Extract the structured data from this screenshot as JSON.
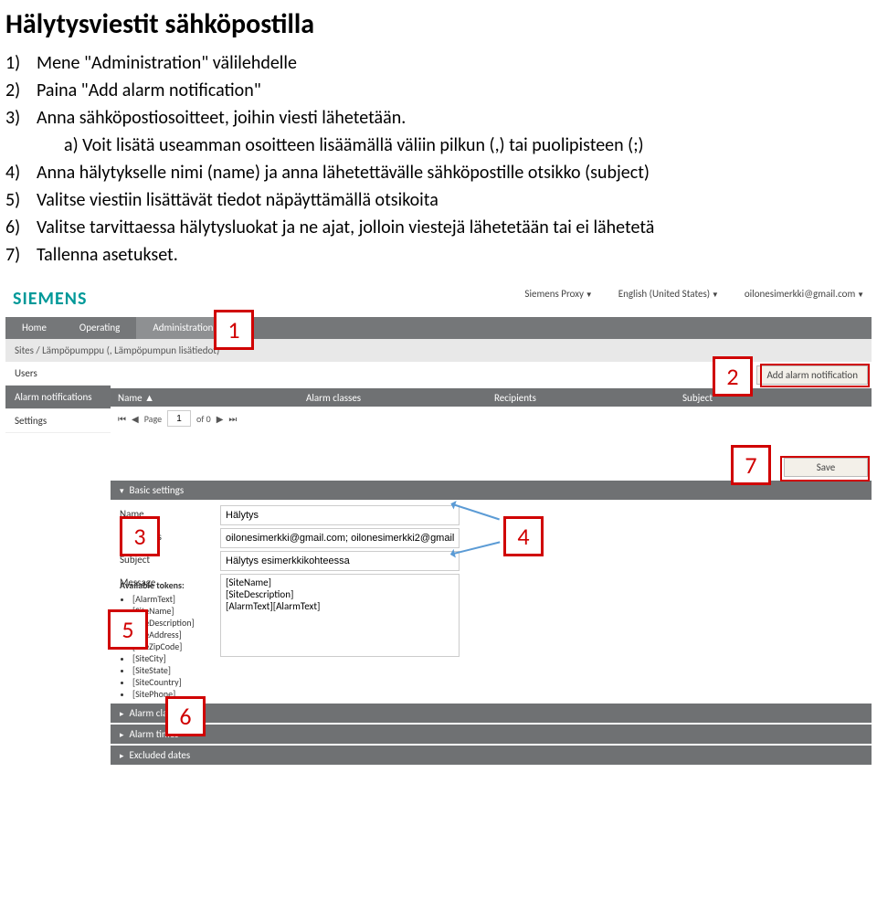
{
  "doc": {
    "title": "Hälytysviestit sähköpostilla",
    "steps": [
      {
        "n": "1)",
        "t": "Mene \"Administration\" välilehdelle"
      },
      {
        "n": "2)",
        "t": "Paina \"Add alarm notification\""
      },
      {
        "n": "3)",
        "t": "Anna sähköpostiosoitteet, joihin viesti lähetetään."
      },
      {
        "n": "",
        "t": "a)   Voit lisätä useamman osoitteen lisäämällä väliin pilkun (,) tai puolipisteen (;)",
        "sub": true
      },
      {
        "n": "4)",
        "t": "Anna hälytykselle nimi (name) ja anna lähetettävälle sähköpostille otsikko (subject)"
      },
      {
        "n": "5)",
        "t": "Valitse viestiin lisättävät tiedot näpäyttämällä otsikoita"
      },
      {
        "n": "6)",
        "t": "Valitse tarvittaessa hälytysluokat ja ne ajat, jolloin viestejä lähetetään tai ei lähetetä"
      },
      {
        "n": "7)",
        "t": "Tallenna asetukset."
      }
    ]
  },
  "ui": {
    "logo": "SIEMENS",
    "top_right": {
      "proxy": "Siemens Proxy",
      "lang": "English (United States)",
      "user": "oilonesimerkki@gmail.com"
    },
    "nav": {
      "home": "Home",
      "operating": "Operating",
      "admin": "Administration"
    },
    "breadcrumb": "Sites  /  Lämpöpumppu (, Lämpöpumpun lisätiedot)",
    "side": {
      "users": "Users",
      "alarm": "Alarm notifications",
      "settings": "Settings"
    },
    "add_btn": "Add alarm notification",
    "table": {
      "name": "Name",
      "classes": "Alarm classes",
      "recipients": "Recipients",
      "subject": "Subject"
    },
    "pager": {
      "page_lbl": "Page",
      "page_val": "1",
      "of_lbl": "of 0"
    },
    "save_btn": "Save",
    "sections": {
      "basic": "Basic settings",
      "classes": "Alarm classes",
      "times": "Alarm times",
      "excluded": "Excluded dates"
    },
    "form": {
      "name_lbl": "Name",
      "name_val": "Hälytys",
      "rec_lbl": "Recipients",
      "rec_val": "oilonesimerkki@gmail.com; oilonesimerkki2@gmail.com",
      "subj_lbl": "Subject",
      "subj_val": "Hälytys esimerkkikohteessa",
      "msg_lbl": "Message",
      "msg_val": "[SiteName]\n[SiteDescription]\n[AlarmText][AlarmText]"
    },
    "tokens": {
      "header": "Available tokens:",
      "list": [
        "[AlarmText]",
        "[SiteName]",
        "[SiteDescription]",
        "[SiteAddress]",
        "[SiteZipCode]",
        "[SiteCity]",
        "[SiteState]",
        "[SiteCountry]",
        "[SitePhone]"
      ]
    }
  },
  "anno": {
    "1": "1",
    "2": "2",
    "3": "3",
    "4": "4",
    "5": "5",
    "6": "6",
    "7": "7"
  }
}
